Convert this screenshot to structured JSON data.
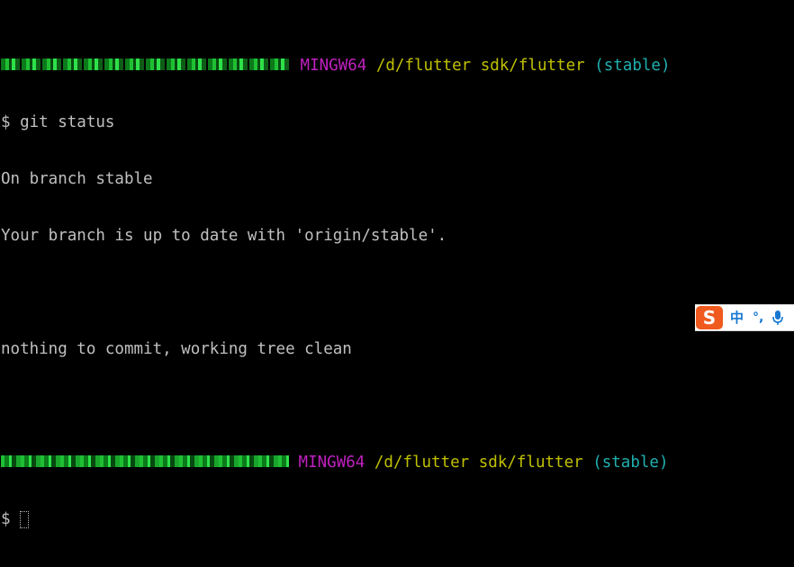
{
  "colors": {
    "background": "#000000",
    "text": "#c0c0c0",
    "user_host": "#1fbf33",
    "mingw": "#c020c0",
    "path": "#c0c000",
    "branch": "#20b0b0",
    "ime_logo": "#f05a1e",
    "ime_text": "#1677d2"
  },
  "terminal": {
    "prompt1": {
      "system": "MINGW64",
      "path": "/d/flutter sdk/flutter",
      "branch": "(stable)"
    },
    "command_line": "$ git status",
    "output": [
      "On branch stable",
      "Your branch is up to date with 'origin/stable'.",
      "",
      "nothing to commit, working tree clean",
      ""
    ],
    "prompt2": {
      "system": "MINGW64",
      "path": "/d/flutter sdk/flutter",
      "branch": "(stable)"
    },
    "input_prompt": "$ "
  },
  "ime": {
    "logo": "S",
    "language": "中",
    "punctuation": "°,",
    "mic_icon": "microphone-icon"
  }
}
